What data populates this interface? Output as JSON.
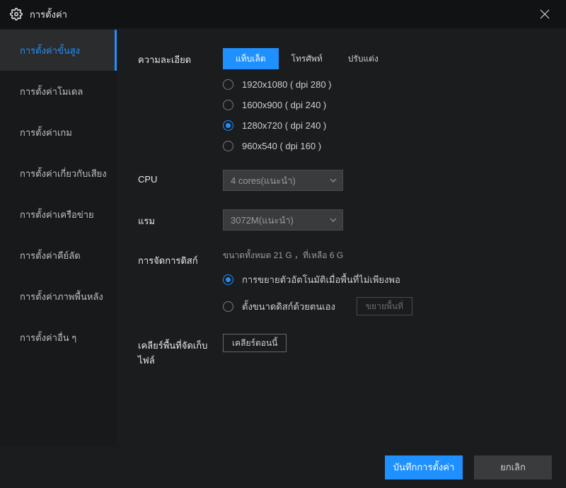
{
  "titlebar": {
    "title": "การตั้งค่า"
  },
  "sidebar": {
    "items": [
      {
        "label": "การตั้งค่าขั้นสูง",
        "active": true
      },
      {
        "label": "การตั้งค่าโมเดล"
      },
      {
        "label": "การตั้งค่าเกม"
      },
      {
        "label": "การตั้งค่าเกี่ยวกับเสียง"
      },
      {
        "label": "การตั้งค่าเครือข่าย"
      },
      {
        "label": "การตั้งค่าคีย์ลัด"
      },
      {
        "label": "การตั้งค่าภาพพื้นหลัง"
      },
      {
        "label": "การตั้งค่าอื่น ๆ"
      }
    ]
  },
  "resolution": {
    "label": "ความละเอียด",
    "tabs": [
      "แท็บเล็ต",
      "โทรศัพท์",
      "ปรับแต่ง"
    ],
    "active_tab": 0,
    "options": [
      "1920x1080 ( dpi 280 )",
      "1600x900 ( dpi 240 )",
      "1280x720 ( dpi 240 )",
      "960x540 ( dpi 160 )"
    ],
    "selected": 2
  },
  "cpu": {
    "label": "CPU",
    "value": "4 cores(แนะนำ)"
  },
  "ram": {
    "label": "แรม",
    "value": "3072M(แนะนำ)"
  },
  "disk": {
    "label": "การจัดการดิสก์",
    "info": "ขนาดทั้งหมด 21 G ，ที่เหลือ 6 G",
    "options": [
      "การขยายตัวอัตโนมัติเมื่อพื้นที่ไม่เพียงพอ",
      "ตั้งขนาดดิสก์ด้วยตนเอง"
    ],
    "selected": 0,
    "expand_btn": "ขยายพื้นที่"
  },
  "clear": {
    "label": "เคลียร์พื้นที่จัดเก็บไฟล์",
    "button": "เคลียร์ตอนนี้"
  },
  "footer": {
    "save": "บันทึกการตั้งค่า",
    "cancel": "ยกเลิก"
  }
}
